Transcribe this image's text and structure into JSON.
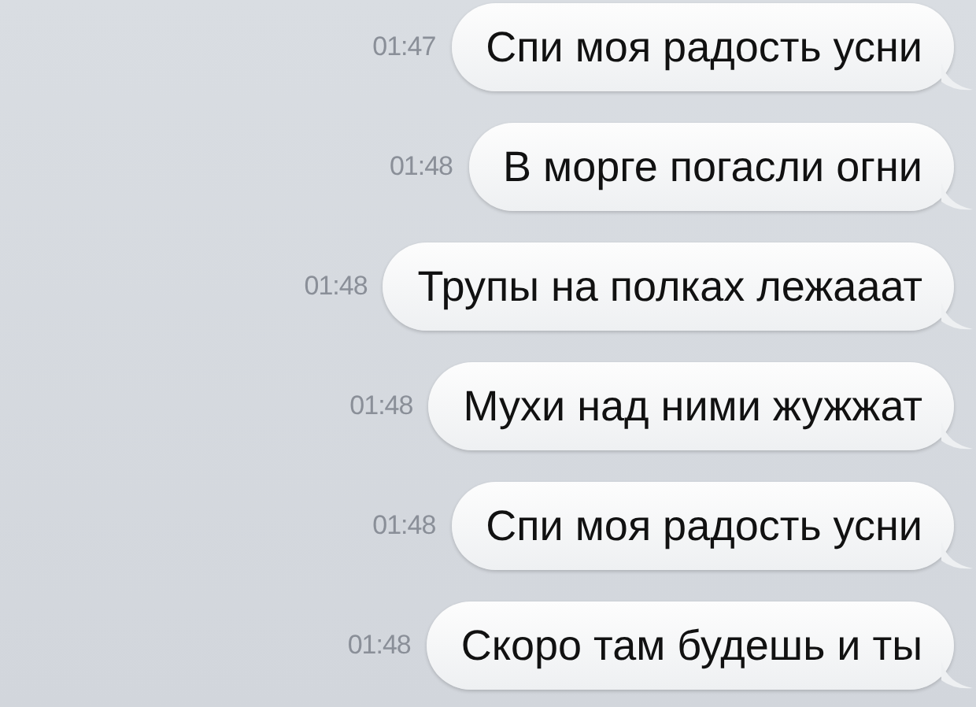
{
  "messages": [
    {
      "time": "01:47",
      "text": "Спи моя радость усни"
    },
    {
      "time": "01:48",
      "text": "В морге погасли огни"
    },
    {
      "time": "01:48",
      "text": "Трупы на полках лежааат"
    },
    {
      "time": "01:48",
      "text": "Мухи над ними жужжат"
    },
    {
      "time": "01:48",
      "text": "Спи моя радость усни"
    },
    {
      "time": "01:48",
      "text": "Скоро там будешь и ты"
    }
  ]
}
